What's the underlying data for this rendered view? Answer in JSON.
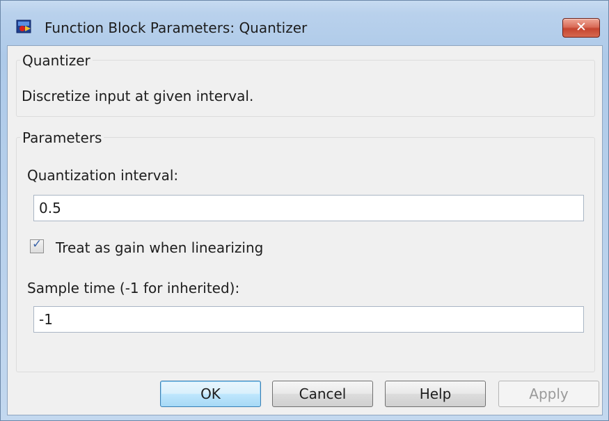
{
  "window": {
    "title": "Function Block Parameters: Quantizer",
    "close_label": "✕",
    "icon": "simulink-block-icon"
  },
  "description_group": {
    "title": "Quantizer",
    "text": "Discretize input at given interval."
  },
  "parameters_group": {
    "title": "Parameters",
    "quantization_interval_label": "Quantization interval:",
    "quantization_interval_value": "0.5",
    "treat_as_gain_label": "Treat as gain when linearizing",
    "treat_as_gain_checked": true,
    "sample_time_label": "Sample time (-1 for inherited):",
    "sample_time_value": "-1"
  },
  "buttons": {
    "ok": "OK",
    "cancel": "Cancel",
    "help": "Help",
    "apply": "Apply"
  }
}
